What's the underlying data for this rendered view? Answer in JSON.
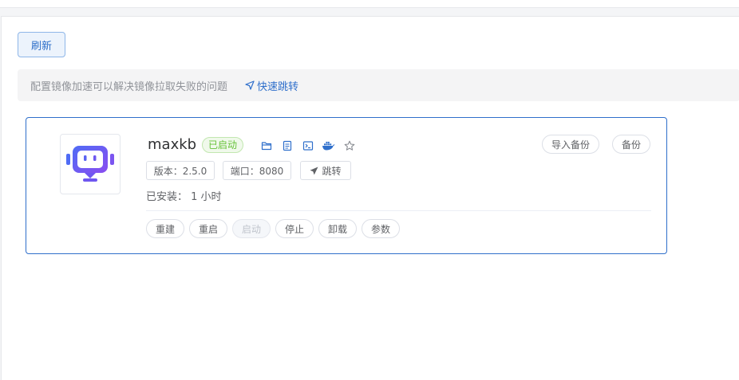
{
  "toolbar": {
    "refresh_label": "刷新"
  },
  "notice": {
    "text": "配置镜像加速可以解决镜像拉取失败的问题",
    "link_label": "快速跳转",
    "link_icon": "navigation-arrow-icon"
  },
  "app": {
    "name": "maxkb",
    "status": "已启动",
    "icons": [
      "folder-icon",
      "document-icon",
      "terminal-icon",
      "docker-icon",
      "star-icon"
    ],
    "version_tag": "版本：2.5.0",
    "port_tag": "端口：8080",
    "jump_label": "跳转",
    "installed_text": "已安装：  1 小时",
    "actions": {
      "rebuild": "重建",
      "restart": "重启",
      "start": "启动",
      "stop": "停止",
      "uninstall": "卸载",
      "params": "参数"
    },
    "import_backup": "导入备份",
    "backup": "备份"
  },
  "colors": {
    "accent": "#2f6fcb",
    "status_green": "#67c23a",
    "logo_gradient_start": "#4f6cf5",
    "logo_gradient_end": "#8a4df0"
  }
}
